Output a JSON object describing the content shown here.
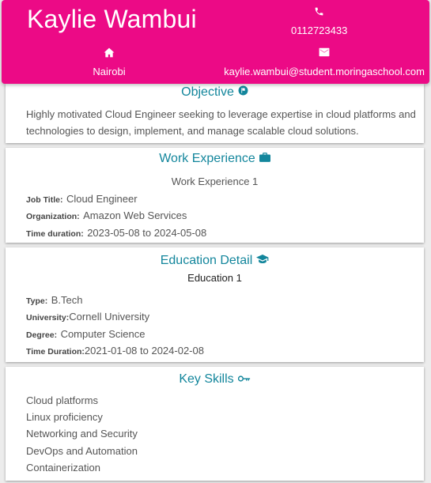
{
  "header": {
    "name": "Kaylie Wambui",
    "phone": "0112723433",
    "location": "Nairobi",
    "email": "kaylie.wambui@student.moringaschool.com",
    "phone_icon": "phone-icon",
    "location_icon": "home-icon",
    "email_icon": "envelope-icon",
    "background_color": "#ec0a86"
  },
  "objective": {
    "title": "Objective",
    "icon": "flag-icon",
    "text": "Highly motivated Cloud Engineer seeking to leverage expertise in cloud platforms and technologies to design, implement, and manage scalable cloud solutions."
  },
  "work": {
    "title": "Work Experience",
    "icon": "briefcase-icon",
    "entries": [
      {
        "heading": "Work Experience 1",
        "job_title_label": "Job Title:",
        "job_title": "Cloud Engineer",
        "organization_label": "Organization:",
        "organization": "Amazon Web Services",
        "duration_label": "Time duration:",
        "duration": "2023-05-08 to 2024-05-08"
      }
    ]
  },
  "education": {
    "title": "Education Detail",
    "icon": "graduation-cap-icon",
    "entries": [
      {
        "heading": "Education 1",
        "type_label": "Type:",
        "type": "B.Tech",
        "university_label": "University:",
        "university": "Cornell University",
        "degree_label": "Degree:",
        "degree": "Computer Science",
        "duration_label": "Time Duration:",
        "duration": "2021-01-08 to 2024-02-08"
      }
    ]
  },
  "skills": {
    "title": "Key Skills",
    "icon": "key-icon",
    "items": [
      "Cloud platforms",
      "Linux proficiency",
      "Networking and Security",
      "DevOps and Automation",
      "Containerization"
    ]
  },
  "accent_color": "#13869c"
}
